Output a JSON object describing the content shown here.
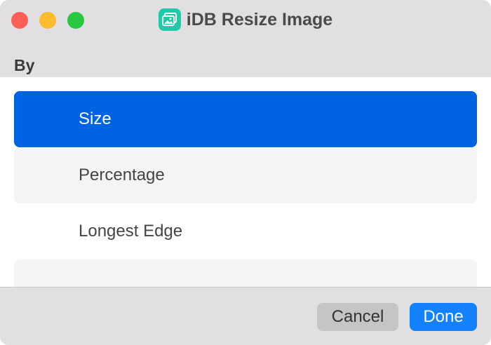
{
  "window": {
    "title": "iDB Resize Image",
    "app_icon": "photos-icon",
    "controls": [
      "close",
      "minimize",
      "zoom"
    ]
  },
  "section": {
    "label": "By"
  },
  "options": [
    {
      "label": "Size",
      "selected": true
    },
    {
      "label": "Percentage",
      "selected": false
    },
    {
      "label": "Longest Edge",
      "selected": false
    },
    {
      "label": "",
      "selected": false
    }
  ],
  "footer": {
    "cancel_label": "Cancel",
    "done_label": "Done"
  },
  "colors": {
    "selected": "#0063e1",
    "done_button": "#1481ff",
    "app_icon": "#20c9a8"
  }
}
